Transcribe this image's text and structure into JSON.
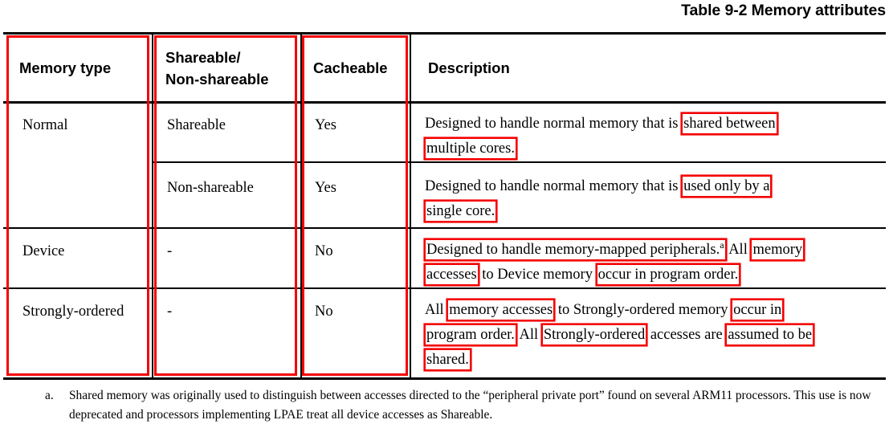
{
  "title": "Table 9-2 Memory attributes",
  "table": {
    "headers": [
      {
        "label": "Memory type",
        "boxed": true
      },
      {
        "label_line1": "Shareable/",
        "label_line2": "Non-shareable",
        "boxed": true
      },
      {
        "label": "Cacheable",
        "boxed": true
      },
      {
        "label": "Description",
        "boxed": false
      }
    ],
    "rows": [
      {
        "memory_type": "Normal",
        "shareable": "Shareable",
        "cacheable": "Yes",
        "description_plain": "Designed to handle normal memory that is shared between multiple cores.",
        "description_lines": [
          [
            {
              "text": "Designed to handle normal memory that is ",
              "highlight": false
            },
            {
              "text": "shared between",
              "highlight": true
            }
          ],
          [
            {
              "text": "multiple cores.",
              "highlight": true
            }
          ]
        ]
      },
      {
        "memory_type": "",
        "shareable": "Non-shareable",
        "cacheable": "Yes",
        "description_plain": "Designed to handle normal memory that is used only by a single core.",
        "description_lines": [
          [
            {
              "text": "Designed to handle normal memory that is ",
              "highlight": false
            },
            {
              "text": "used only by a",
              "highlight": true
            }
          ],
          [
            {
              "text": "single core.",
              "highlight": true
            }
          ]
        ]
      },
      {
        "memory_type": "Device",
        "shareable": "-",
        "cacheable": "No",
        "description_plain": "Designed to handle memory-mapped peripherals.a All memory accesses to Device memory occur in program order.",
        "description_lines": [
          [
            {
              "text": "Designed to handle memory-mapped peripherals.",
              "highlight": true,
              "superscript": "a"
            },
            {
              "text": " All ",
              "highlight": false
            },
            {
              "text": "memory",
              "highlight": true
            }
          ],
          [
            {
              "text": "accesses",
              "highlight": true
            },
            {
              "text": " to Device memory ",
              "highlight": false
            },
            {
              "text": "occur in program order.",
              "highlight": true
            }
          ]
        ]
      },
      {
        "memory_type": "Strongly-ordered",
        "shareable": "-",
        "cacheable": "No",
        "description_plain": "All memory accesses to Strongly-ordered memory occur in program order. All Strongly-ordered accesses are assumed to be shared.",
        "description_lines": [
          [
            {
              "text": "All ",
              "highlight": false
            },
            {
              "text": "memory accesses",
              "highlight": true
            },
            {
              "text": " to Strongly-ordered memory ",
              "highlight": false
            },
            {
              "text": "occur in",
              "highlight": true
            }
          ],
          [
            {
              "text": "program order.",
              "highlight": true
            },
            {
              "text": " All ",
              "highlight": false
            },
            {
              "text": "Strongly-ordered",
              "highlight": true
            },
            {
              "text": " accesses are ",
              "highlight": false
            },
            {
              "text": "assumed to be",
              "highlight": true
            }
          ],
          [
            {
              "text": "shared.",
              "highlight": true
            }
          ]
        ]
      }
    ]
  },
  "footnote": {
    "marker": "a.",
    "text": "Shared memory was originally used to distinguish between accesses directed to the “peripheral private port” found on several ARM11 processors. This use is now deprecated and processors implementing LPAE treat all device accesses as Shareable."
  },
  "colors": {
    "annotation_red": "#f40000",
    "text": "#000000",
    "rule": "#000000",
    "background": "#ffffff"
  }
}
